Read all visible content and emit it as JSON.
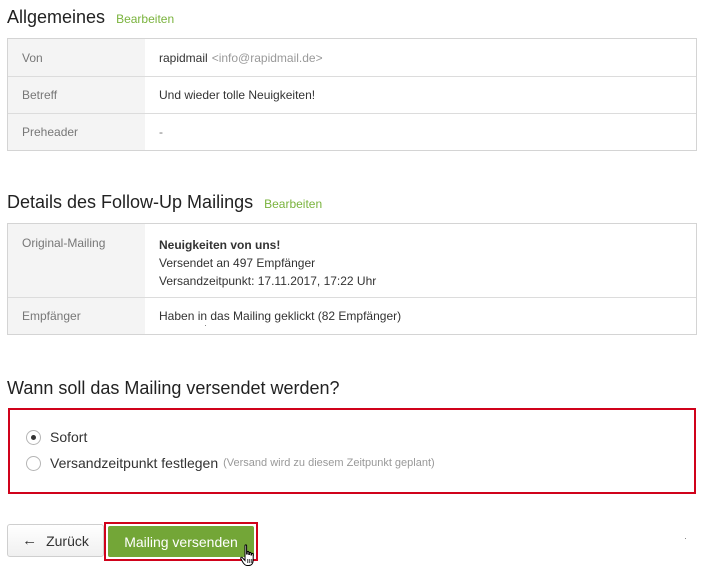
{
  "general": {
    "title": "Allgemeines",
    "edit_label": "Bearbeiten",
    "rows": {
      "from_label": "Von",
      "from_name": "rapidmail",
      "from_email": "<info@rapidmail.de>",
      "subject_label": "Betreff",
      "subject_value": "Und wieder tolle Neuigkeiten!",
      "preheader_label": "Preheader",
      "preheader_value": "-"
    }
  },
  "followup": {
    "title": "Details des Follow-Up Mailings",
    "edit_label": "Bearbeiten",
    "rows": {
      "original_label": "Original-Mailing",
      "original_name": "Neuigkeiten von uns!",
      "original_sent": "Versendet an 497 Empfänger",
      "original_time": "Versandzeitpunkt: 17.11.2017, 17:22 Uhr",
      "recipients_label": "Empfänger",
      "recipients_value": "Haben in das Mailing geklickt (82 Empfänger)"
    }
  },
  "schedule": {
    "title": "Wann soll das Mailing versendet werden?",
    "option_now": "Sofort",
    "option_later": "Versandzeitpunkt festlegen",
    "option_later_hint": "(Versand wird zu diesem Zeitpunkt geplant)",
    "selected": "Sofort"
  },
  "actions": {
    "back_label": "Zurück",
    "send_label": "Mailing versenden"
  },
  "colors": {
    "accent_green": "#73a637",
    "link_green": "#7ab33d",
    "highlight_red": "#d0021b"
  }
}
